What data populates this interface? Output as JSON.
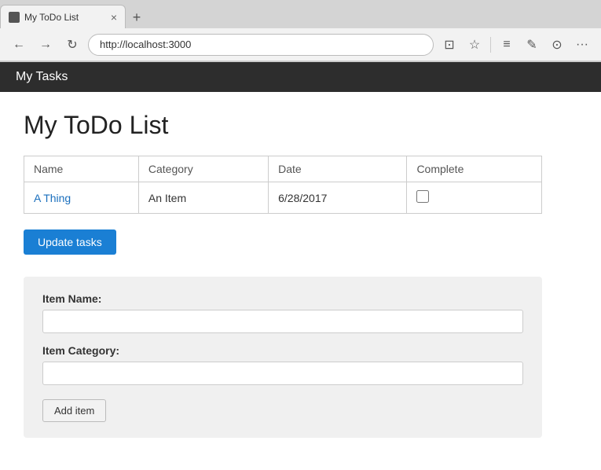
{
  "browser": {
    "tab_favicon": "page-icon",
    "tab_label": "My ToDo List",
    "tab_close": "×",
    "new_tab_icon": "+",
    "back_icon": "←",
    "forward_icon": "→",
    "reload_icon": "↻",
    "address": "http://localhost:3000",
    "reader_icon": "⊡",
    "bookmark_icon": "☆",
    "separator": "",
    "menu_icon": "≡",
    "edit_icon": "✎",
    "profile_icon": "⊙",
    "more_icon": "···"
  },
  "app": {
    "header_title": "My Tasks",
    "page_title": "My ToDo List",
    "table": {
      "columns": [
        "Name",
        "Category",
        "Date",
        "Complete"
      ],
      "rows": [
        {
          "name": "A Thing",
          "category": "An Item",
          "date": "6/28/2017",
          "complete": false
        }
      ]
    },
    "update_button": "Update tasks",
    "form": {
      "item_name_label": "Item Name:",
      "item_name_placeholder": "",
      "item_category_label": "Item Category:",
      "item_category_placeholder": "",
      "add_button": "Add item"
    }
  }
}
